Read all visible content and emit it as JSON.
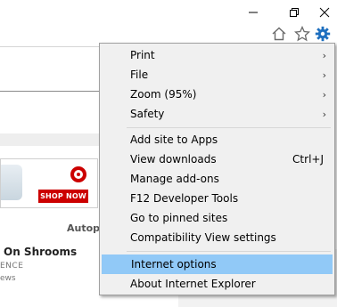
{
  "window": {
    "minimize_icon": "minimize-icon",
    "restore_icon": "restore-icon",
    "close_icon": "close-icon"
  },
  "toolbar": {
    "home_icon": "home-icon",
    "favorites_icon": "star-icon",
    "tools_icon": "gear-icon",
    "accent": "#1e6fbf"
  },
  "page": {
    "ad_button": "SHOP NOW",
    "autoplay_label": "Autopl",
    "headline": "On Shrooms",
    "subline1": "ENCE",
    "subline2": "ews"
  },
  "menu": {
    "highlight_color": "#91c9f7",
    "items": [
      {
        "label": "Print",
        "submenu": true
      },
      {
        "label": "File",
        "submenu": true
      },
      {
        "label": "Zoom (95%)",
        "submenu": true
      },
      {
        "label": "Safety",
        "submenu": true
      },
      {
        "label": "Add site to Apps"
      },
      {
        "label": "View downloads",
        "shortcut": "Ctrl+J"
      },
      {
        "label": "Manage add-ons"
      },
      {
        "label": "F12 Developer Tools"
      },
      {
        "label": "Go to pinned sites"
      },
      {
        "label": "Compatibility View settings"
      },
      {
        "label": "Internet options",
        "highlighted": true
      },
      {
        "label": "About Internet Explorer"
      }
    ],
    "arrow_glyph": "›"
  }
}
